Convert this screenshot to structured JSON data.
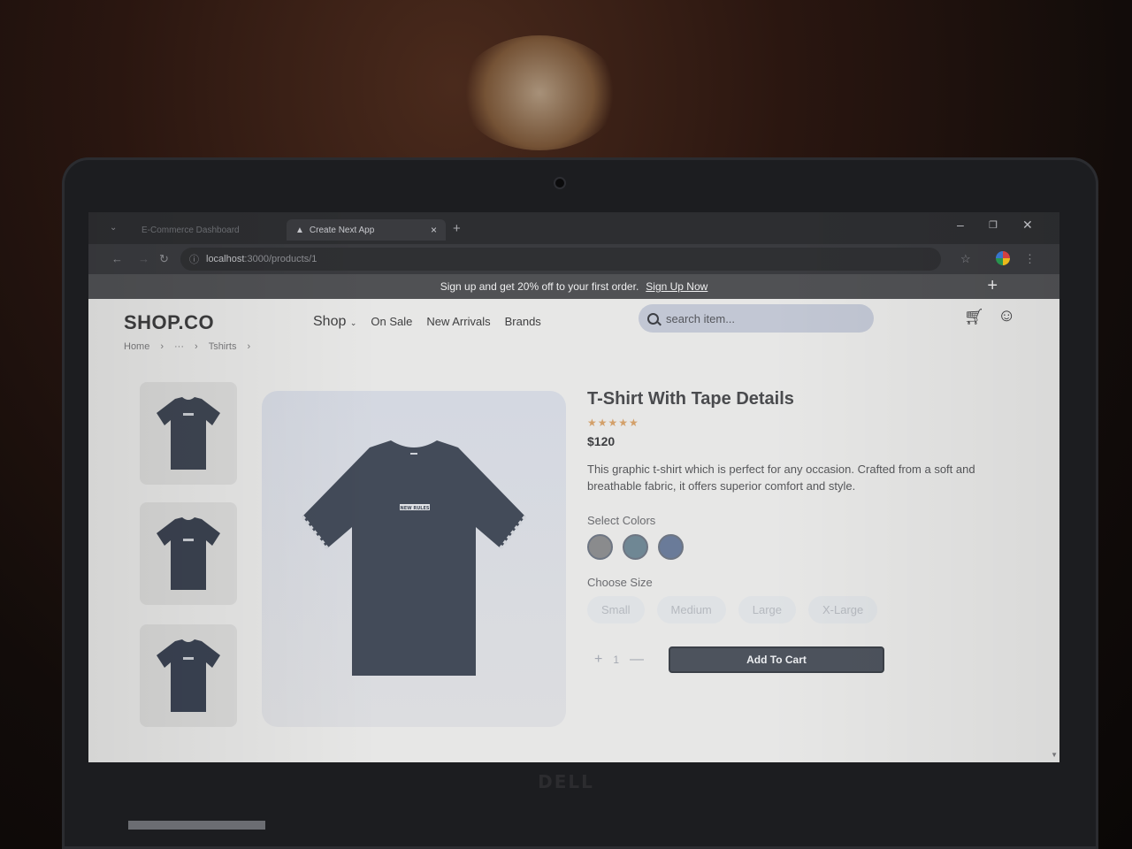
{
  "browser": {
    "tabs": [
      {
        "label": "E-Commerce Dashboard"
      },
      {
        "label": "Create Next App",
        "active": true
      }
    ],
    "url_host": "localhost",
    "url_path": ":3000/products/1"
  },
  "promo": {
    "text": "Sign up and get 20% off to your first order.",
    "link": "Sign Up Now",
    "close": "+"
  },
  "header": {
    "logo": "SHOP.CO",
    "nav": {
      "shop": "Shop",
      "on_sale": "On Sale",
      "new_arrivals": "New Arrivals",
      "brands": "Brands"
    },
    "search_placeholder": "search item...",
    "icons": [
      "cart-icon",
      "user-icon"
    ]
  },
  "breadcrumb": [
    "Home",
    "···",
    "Tshirts"
  ],
  "product": {
    "title": "T-Shirt With Tape Details",
    "rating": 5,
    "stars": "★★★★★",
    "price": "$120",
    "description": "This graphic t-shirt which is perfect for any occasion. Crafted from a soft and breathable fabric, it offers superior comfort and style.",
    "colors_label": "Select Colors",
    "colors": [
      "#8a8b8d",
      "#6f8794",
      "#6a7b99"
    ],
    "size_label": "Choose Size",
    "sizes": [
      "Small",
      "Medium",
      "Large",
      "X-Large"
    ],
    "quantity": "1",
    "add_to_cart": "Add To Cart",
    "shirt_text": "NEW RULES"
  }
}
